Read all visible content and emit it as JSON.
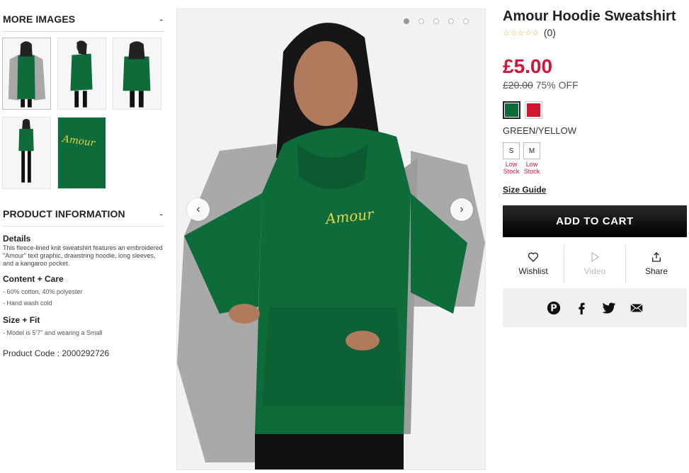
{
  "more_images": {
    "title": "MORE IMAGES",
    "toggle": "-",
    "thumbnails": [
      {
        "alt": "front with blazer"
      },
      {
        "alt": "side view"
      },
      {
        "alt": "back view"
      },
      {
        "alt": "full length front"
      },
      {
        "alt": "embroidery detail",
        "detail_text": "Amour"
      }
    ]
  },
  "product_info": {
    "title": "PRODUCT INFORMATION",
    "toggle": "-",
    "details_heading": "Details",
    "details_text": "This fleece-lined knit sweatshirt features an embroidered \"Amour\" text graphic, drawstring hoodie, long sleeves, and a kangaroo pocket.",
    "content_heading": "Content + Care",
    "content_items": [
      "- 60% cotton, 40% polyester",
      "- Hand wash cold"
    ],
    "size_heading": "Size + Fit",
    "size_items": [
      "- Model is 5'7\" and wearing a Small"
    ],
    "product_code": "Product Code : 2000292726"
  },
  "gallery": {
    "slide_count": 5,
    "active_slide": 1,
    "prev_label": "‹",
    "next_label": "›",
    "hoodie_text": "Amour"
  },
  "product": {
    "title": "Amour Hoodie Sweatshirt",
    "stars": "☆☆☆☆☆",
    "review_count": "(0)",
    "price": "£5.00",
    "original_price": "£20.00",
    "discount": "75% OFF",
    "colors": [
      {
        "name": "GREEN/YELLOW",
        "hex": "#0e6b3a",
        "selected": true
      },
      {
        "name": "RED",
        "hex": "#d2162f",
        "selected": false
      }
    ],
    "selected_color_name": "GREEN/YELLOW",
    "sizes": [
      {
        "label": "S",
        "stock": "Low Stock"
      },
      {
        "label": "M",
        "stock": "Low Stock"
      }
    ],
    "size_guide": "Size Guide",
    "add_to_cart": "ADD TO CART",
    "actions": [
      {
        "label": "Wishlist",
        "icon": "heart-icon"
      },
      {
        "label": "Video",
        "icon": "play-icon"
      },
      {
        "label": "Share",
        "icon": "share-icon"
      }
    ],
    "social_icons": [
      "pinterest-icon",
      "facebook-icon",
      "twitter-icon",
      "email-icon"
    ]
  },
  "colors": {
    "accent_red": "#d2163a",
    "hoodie_green": "#0e6b3a",
    "embroidery_yellow": "#e8d44a"
  }
}
